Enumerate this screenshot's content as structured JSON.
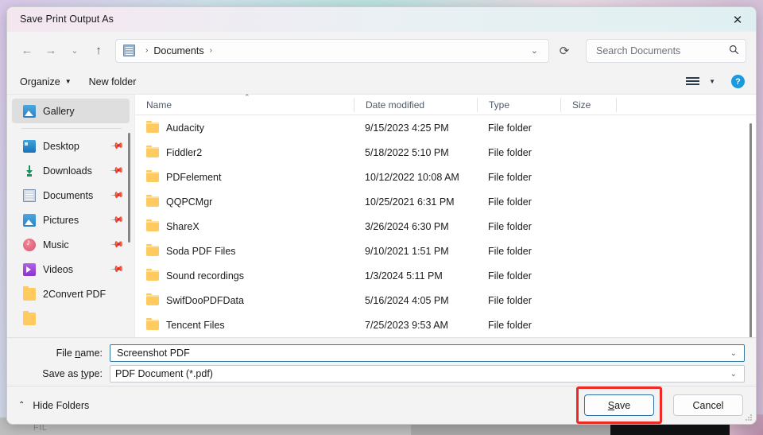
{
  "window": {
    "title": "Save Print Output As",
    "close_label": "✕"
  },
  "nav": {
    "back": "←",
    "forward": "→",
    "recent": "⌄",
    "up": "↑",
    "breadcrumb": {
      "icon": "documents-icon",
      "path": "Documents",
      "separator": "›"
    },
    "address_chevron": "⌄",
    "refresh": "⟳",
    "search": {
      "placeholder": "Search Documents",
      "value": "",
      "icon": "search-icon"
    }
  },
  "commandbar": {
    "organize": "Organize",
    "organize_caret": "▼",
    "new_folder": "New folder",
    "view_caret": "▼",
    "help": "?"
  },
  "sidebar": {
    "gallery": {
      "label": "Gallery",
      "icon": "gallery-icon",
      "selected": true
    },
    "items": [
      {
        "label": "Desktop",
        "icon": "desktop-icon",
        "pinned": true
      },
      {
        "label": "Downloads",
        "icon": "download-icon",
        "pinned": true
      },
      {
        "label": "Documents",
        "icon": "documents-icon",
        "pinned": true
      },
      {
        "label": "Pictures",
        "icon": "pictures-icon",
        "pinned": true
      },
      {
        "label": "Music",
        "icon": "music-icon",
        "pinned": true
      },
      {
        "label": "Videos",
        "icon": "videos-icon",
        "pinned": true
      },
      {
        "label": "2Convert PDF",
        "icon": "folder-icon",
        "pinned": false
      }
    ],
    "pin_glyph": "📌"
  },
  "filelist": {
    "columns": [
      "Name",
      "Date modified",
      "Type",
      "Size"
    ],
    "sort_caret": "⌃",
    "rows": [
      {
        "name": "Audacity",
        "date": "9/15/2023 4:25 PM",
        "type": "File folder",
        "size": ""
      },
      {
        "name": "Fiddler2",
        "date": "5/18/2022 5:10 PM",
        "type": "File folder",
        "size": ""
      },
      {
        "name": "PDFelement",
        "date": "10/12/2022 10:08 AM",
        "type": "File folder",
        "size": ""
      },
      {
        "name": "QQPCMgr",
        "date": "10/25/2021 6:31 PM",
        "type": "File folder",
        "size": ""
      },
      {
        "name": "ShareX",
        "date": "3/26/2024 6:30 PM",
        "type": "File folder",
        "size": ""
      },
      {
        "name": "Soda PDF Files",
        "date": "9/10/2021 1:51 PM",
        "type": "File folder",
        "size": ""
      },
      {
        "name": "Sound recordings",
        "date": "1/3/2024 5:11 PM",
        "type": "File folder",
        "size": ""
      },
      {
        "name": "SwifDooPDFData",
        "date": "5/16/2024 4:05 PM",
        "type": "File folder",
        "size": ""
      },
      {
        "name": "Tencent Files",
        "date": "7/25/2023 9:53 AM",
        "type": "File folder",
        "size": ""
      }
    ]
  },
  "form": {
    "filename_label_pre": "File ",
    "filename_label_key": "n",
    "filename_label_post": "ame:",
    "filename_value": "Screenshot PDF",
    "savetype_label_pre": "Save as ",
    "savetype_label_key": "t",
    "savetype_label_post": "ype:",
    "savetype_value": "PDF Document (*.pdf)",
    "dropdown_caret": "⌄"
  },
  "footer": {
    "hide_folders": "Hide Folders",
    "hide_caret": "⌃",
    "save_pre": "",
    "save_key": "S",
    "save_post": "ave",
    "cancel": "Cancel",
    "highlight_color": "#ee2a24"
  },
  "background": {
    "ghost_text": "FIL"
  }
}
